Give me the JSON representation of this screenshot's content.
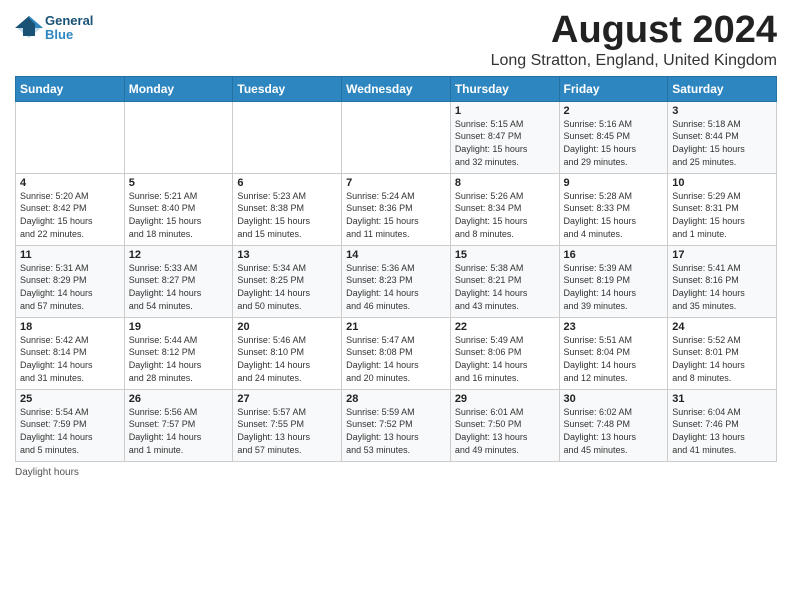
{
  "header": {
    "logo_general": "General",
    "logo_blue": "Blue",
    "month_title": "August 2024",
    "location": "Long Stratton, England, United Kingdom"
  },
  "days_of_week": [
    "Sunday",
    "Monday",
    "Tuesday",
    "Wednesday",
    "Thursday",
    "Friday",
    "Saturday"
  ],
  "weeks": [
    [
      {
        "day": "",
        "info": ""
      },
      {
        "day": "",
        "info": ""
      },
      {
        "day": "",
        "info": ""
      },
      {
        "day": "",
        "info": ""
      },
      {
        "day": "1",
        "info": "Sunrise: 5:15 AM\nSunset: 8:47 PM\nDaylight: 15 hours\nand 32 minutes."
      },
      {
        "day": "2",
        "info": "Sunrise: 5:16 AM\nSunset: 8:45 PM\nDaylight: 15 hours\nand 29 minutes."
      },
      {
        "day": "3",
        "info": "Sunrise: 5:18 AM\nSunset: 8:44 PM\nDaylight: 15 hours\nand 25 minutes."
      }
    ],
    [
      {
        "day": "4",
        "info": "Sunrise: 5:20 AM\nSunset: 8:42 PM\nDaylight: 15 hours\nand 22 minutes."
      },
      {
        "day": "5",
        "info": "Sunrise: 5:21 AM\nSunset: 8:40 PM\nDaylight: 15 hours\nand 18 minutes."
      },
      {
        "day": "6",
        "info": "Sunrise: 5:23 AM\nSunset: 8:38 PM\nDaylight: 15 hours\nand 15 minutes."
      },
      {
        "day": "7",
        "info": "Sunrise: 5:24 AM\nSunset: 8:36 PM\nDaylight: 15 hours\nand 11 minutes."
      },
      {
        "day": "8",
        "info": "Sunrise: 5:26 AM\nSunset: 8:34 PM\nDaylight: 15 hours\nand 8 minutes."
      },
      {
        "day": "9",
        "info": "Sunrise: 5:28 AM\nSunset: 8:33 PM\nDaylight: 15 hours\nand 4 minutes."
      },
      {
        "day": "10",
        "info": "Sunrise: 5:29 AM\nSunset: 8:31 PM\nDaylight: 15 hours\nand 1 minute."
      }
    ],
    [
      {
        "day": "11",
        "info": "Sunrise: 5:31 AM\nSunset: 8:29 PM\nDaylight: 14 hours\nand 57 minutes."
      },
      {
        "day": "12",
        "info": "Sunrise: 5:33 AM\nSunset: 8:27 PM\nDaylight: 14 hours\nand 54 minutes."
      },
      {
        "day": "13",
        "info": "Sunrise: 5:34 AM\nSunset: 8:25 PM\nDaylight: 14 hours\nand 50 minutes."
      },
      {
        "day": "14",
        "info": "Sunrise: 5:36 AM\nSunset: 8:23 PM\nDaylight: 14 hours\nand 46 minutes."
      },
      {
        "day": "15",
        "info": "Sunrise: 5:38 AM\nSunset: 8:21 PM\nDaylight: 14 hours\nand 43 minutes."
      },
      {
        "day": "16",
        "info": "Sunrise: 5:39 AM\nSunset: 8:19 PM\nDaylight: 14 hours\nand 39 minutes."
      },
      {
        "day": "17",
        "info": "Sunrise: 5:41 AM\nSunset: 8:16 PM\nDaylight: 14 hours\nand 35 minutes."
      }
    ],
    [
      {
        "day": "18",
        "info": "Sunrise: 5:42 AM\nSunset: 8:14 PM\nDaylight: 14 hours\nand 31 minutes."
      },
      {
        "day": "19",
        "info": "Sunrise: 5:44 AM\nSunset: 8:12 PM\nDaylight: 14 hours\nand 28 minutes."
      },
      {
        "day": "20",
        "info": "Sunrise: 5:46 AM\nSunset: 8:10 PM\nDaylight: 14 hours\nand 24 minutes."
      },
      {
        "day": "21",
        "info": "Sunrise: 5:47 AM\nSunset: 8:08 PM\nDaylight: 14 hours\nand 20 minutes."
      },
      {
        "day": "22",
        "info": "Sunrise: 5:49 AM\nSunset: 8:06 PM\nDaylight: 14 hours\nand 16 minutes."
      },
      {
        "day": "23",
        "info": "Sunrise: 5:51 AM\nSunset: 8:04 PM\nDaylight: 14 hours\nand 12 minutes."
      },
      {
        "day": "24",
        "info": "Sunrise: 5:52 AM\nSunset: 8:01 PM\nDaylight: 14 hours\nand 8 minutes."
      }
    ],
    [
      {
        "day": "25",
        "info": "Sunrise: 5:54 AM\nSunset: 7:59 PM\nDaylight: 14 hours\nand 5 minutes."
      },
      {
        "day": "26",
        "info": "Sunrise: 5:56 AM\nSunset: 7:57 PM\nDaylight: 14 hours\nand 1 minute."
      },
      {
        "day": "27",
        "info": "Sunrise: 5:57 AM\nSunset: 7:55 PM\nDaylight: 13 hours\nand 57 minutes."
      },
      {
        "day": "28",
        "info": "Sunrise: 5:59 AM\nSunset: 7:52 PM\nDaylight: 13 hours\nand 53 minutes."
      },
      {
        "day": "29",
        "info": "Sunrise: 6:01 AM\nSunset: 7:50 PM\nDaylight: 13 hours\nand 49 minutes."
      },
      {
        "day": "30",
        "info": "Sunrise: 6:02 AM\nSunset: 7:48 PM\nDaylight: 13 hours\nand 45 minutes."
      },
      {
        "day": "31",
        "info": "Sunrise: 6:04 AM\nSunset: 7:46 PM\nDaylight: 13 hours\nand 41 minutes."
      }
    ]
  ],
  "footer": {
    "daylight_label": "Daylight hours"
  }
}
